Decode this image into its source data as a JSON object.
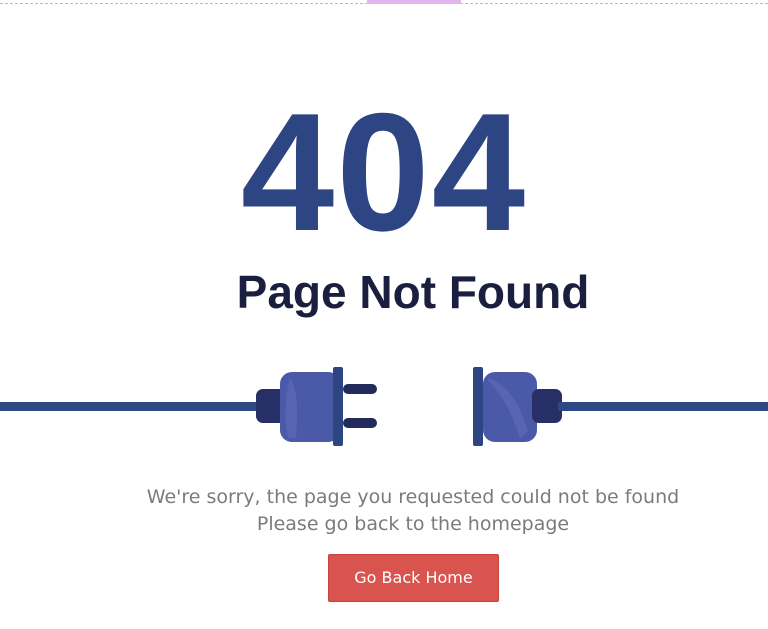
{
  "error": {
    "code": "404",
    "title": "Page Not Found"
  },
  "message": {
    "line1": "We're sorry, the page you requested could not be found",
    "line2": "Please go back to the homepage"
  },
  "button": {
    "label": "Go Back Home"
  },
  "illustration": {
    "name": "unplugged-cable",
    "icons": [
      "plug-icon",
      "socket-icon"
    ]
  },
  "colors": {
    "code": "#2e4584",
    "title": "#1b1f3f",
    "message": "#7b7b7b",
    "button_bg": "#d9534f",
    "button_text": "#ffffff",
    "cable": "#2f4785",
    "plug_body": "#4b5aa8",
    "plug_dark": "#232a5c"
  }
}
